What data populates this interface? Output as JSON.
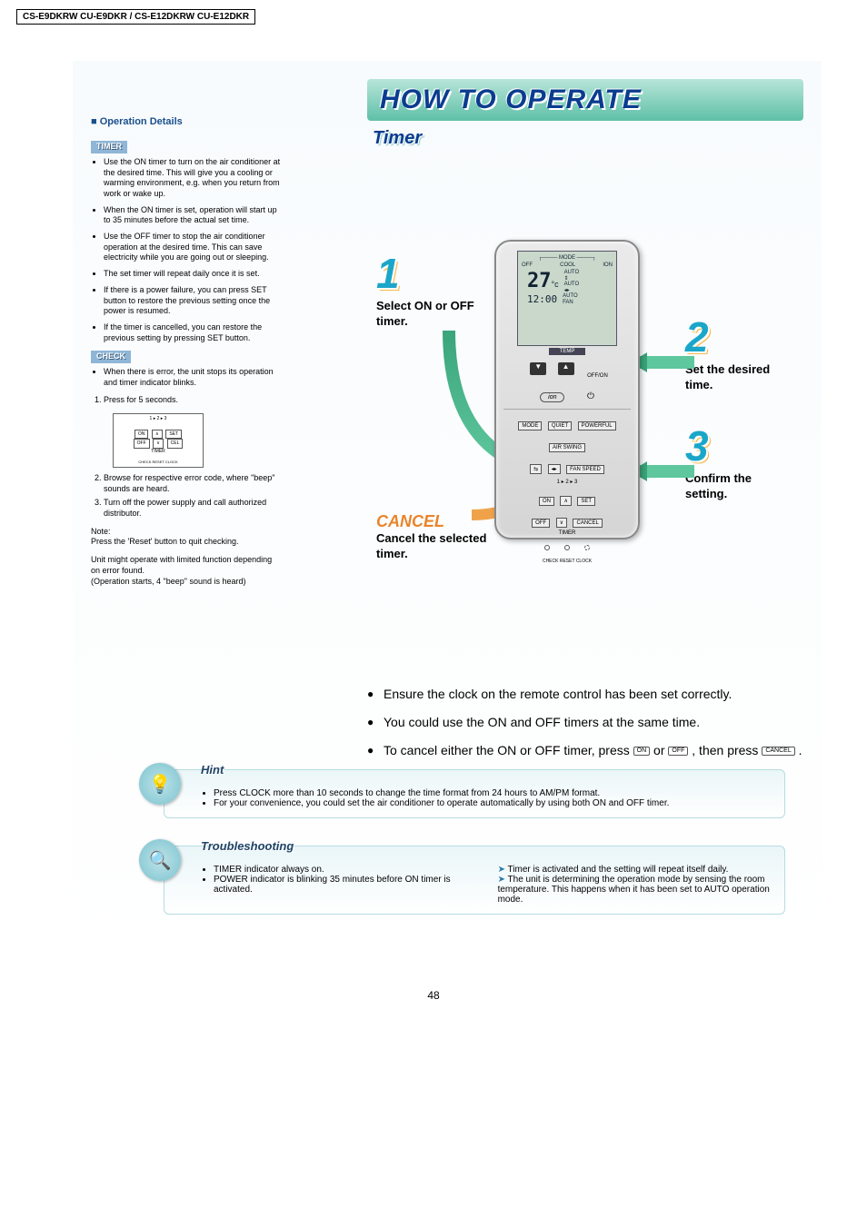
{
  "header": {
    "model": "CS-E9DKRW CU-E9DKR / CS-E12DKRW CU-E12DKR"
  },
  "left": {
    "op_details": "■ Operation Details",
    "timer_tag": "TIMER",
    "timer_bullets": [
      "Use the ON timer to turn on the air conditioner at the desired time. This will give you a cooling or warming environment, e.g. when you return from work or wake up.",
      "When the ON timer is set, operation will start up to 35 minutes before the actual set time.",
      "Use the OFF timer to stop the air conditioner operation at the desired time. This can save electricity while you are going out or sleeping.",
      "The set timer will repeat daily once it is set.",
      "If there is a power failure, you can press SET button to restore the previous setting once the power is resumed.",
      "If the timer is cancelled, you can restore the previous setting by pressing SET button."
    ],
    "check_tag": "CHECK",
    "check_bullet": "When there is error, the unit stops its operation and timer indicator blinks.",
    "check_steps": [
      "Press for 5 seconds.",
      "Browse for respective error code, where \"beep\" sounds are heard.",
      "Turn off the power supply and call authorized distributor."
    ],
    "diagram": {
      "nums": "1   ▸   2   ▸   3",
      "row1_a": "ON",
      "row1_b": "∧",
      "row1_c": "SET",
      "row2_a": "OFF",
      "row2_b": "∨",
      "row2_c": "CEL",
      "timer": "TIMER",
      "bottom": "CHECK  RESET  CLOCK"
    },
    "note_label": "Note:",
    "note_text": "Press the 'Reset' button to quit checking.",
    "note_extra": "Unit might operate with limited function depending on error found.\n(Operation starts, 4 \"beep\" sound is heard)"
  },
  "right": {
    "title": "HOW TO OPERATE",
    "subsection": "Timer",
    "step1_num": "1",
    "step1_label": "Select ON or OFF timer.",
    "step2_num": "2",
    "step2_label": "Set the desired time.",
    "step3_num": "3",
    "step3_label": "Confirm the setting.",
    "cancel_title": "CANCEL",
    "cancel_label": "Cancel the selected timer.",
    "remote": {
      "mode_label": "MODE",
      "off": "OFF",
      "cool": "COOL",
      "ion": "ION",
      "temp": "27",
      "unit": "°c",
      "auto": "AUTO",
      "auto2": "AUTO",
      "lr": "◂▸",
      "clock": "12:00",
      "auto_fan": "AUTO\nFAN",
      "temp_label": "TEMP",
      "offon": "OFF/ON",
      "ion_btn": "ion",
      "power": "⏻",
      "b_mode": "MODE",
      "b_quiet": "QUIET",
      "b_power": "POWERFUL",
      "b_air": "AIR SWING",
      "b_fan": "FAN SPEED",
      "nums": "1   ▸   2   ▸   3",
      "b_on": "ON",
      "b_up": "∧",
      "b_set": "SET",
      "b_off": "OFF",
      "b_down": "∨",
      "b_cancel": "CANCEL",
      "timer": "TIMER",
      "bottom": "CHECK   RESET   CLOCK"
    },
    "notes": [
      "Ensure the clock on the remote control has been set correctly.",
      "You could use the ON and OFF timers at the same time."
    ],
    "note3_pre": "To cancel either the ON or OFF timer, press ",
    "note3_on": "ON",
    "note3_or": " or ",
    "note3_off": "OFF",
    "note3_mid": " , then press ",
    "note3_cancel": "CANCEL",
    "note3_end": " ."
  },
  "hint": {
    "title": "Hint",
    "bullets": [
      "Press CLOCK more than 10 seconds to change the time format from 24 hours to AM/PM format.",
      "For your convenience, you could set the air conditioner to operate automatically by using both ON and OFF timer."
    ]
  },
  "trouble": {
    "title": "Troubleshooting",
    "problems": [
      "TIMER indicator always on.",
      "POWER indicator is blinking 35 minutes before ON timer is activated."
    ],
    "answers": [
      "Timer is activated and the setting will repeat itself daily.",
      "The unit is determining the operation mode by sensing the room temperature. This happens when it has been set to AUTO operation mode."
    ]
  },
  "page_number": "48"
}
